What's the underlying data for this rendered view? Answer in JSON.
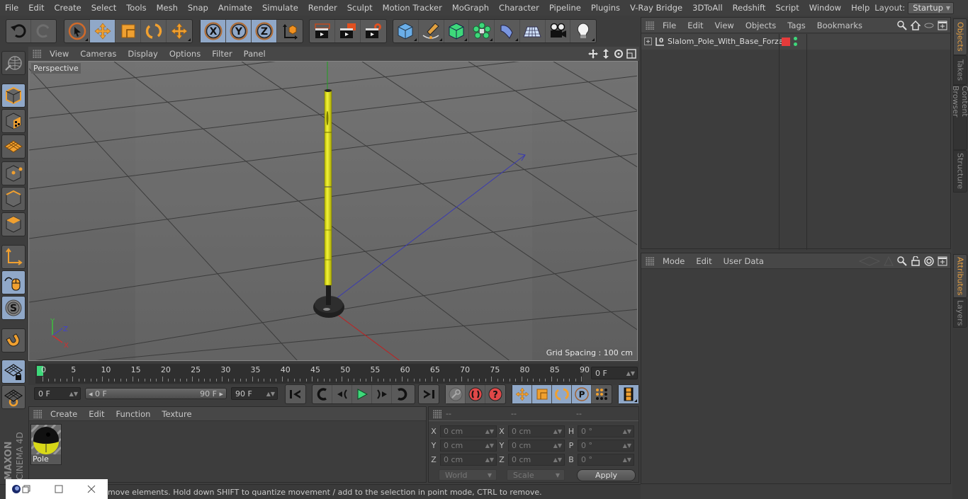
{
  "menubar": {
    "items": [
      "File",
      "Edit",
      "Create",
      "Select",
      "Tools",
      "Mesh",
      "Snap",
      "Animate",
      "Simulate",
      "Render",
      "Sculpt",
      "Motion Tracker",
      "MoGraph",
      "Character",
      "Pipeline",
      "Plugins",
      "V-Ray Bridge",
      "3DToAll",
      "Redshift",
      "Script",
      "Window",
      "Help"
    ],
    "layout_label": "Layout:",
    "layout_value": "Startup"
  },
  "toolbar": {
    "axis_x": "X",
    "axis_y": "Y",
    "axis_z": "Z"
  },
  "viewport": {
    "menu": [
      "View",
      "Cameras",
      "Display",
      "Options",
      "Filter",
      "Panel"
    ],
    "camera_label": "Perspective",
    "grid_spacing": "Grid Spacing : 100 cm",
    "axis_labels": {
      "x": "X",
      "y": "Y",
      "z": "Z"
    }
  },
  "timeline": {
    "ticks": [
      "0",
      "5",
      "10",
      "15",
      "20",
      "25",
      "30",
      "35",
      "40",
      "45",
      "50",
      "55",
      "60",
      "65",
      "70",
      "75",
      "80",
      "85",
      "90"
    ],
    "current_frame": "0 F",
    "start_frame": "0 F",
    "range_start": "0 F",
    "range_end": "90 F",
    "end_frame": "90 F"
  },
  "material_manager": {
    "menu": [
      "Create",
      "Edit",
      "Function",
      "Texture"
    ],
    "materials": [
      {
        "name": "Pole"
      }
    ]
  },
  "coordinates": {
    "headers": [
      "--",
      "--",
      "--"
    ],
    "rows": [
      {
        "l1": "X",
        "v1": "0 cm",
        "l2": "X",
        "v2": "0 cm",
        "l3": "H",
        "v3": "0 °"
      },
      {
        "l1": "Y",
        "v1": "0 cm",
        "l2": "Y",
        "v2": "0 cm",
        "l3": "P",
        "v3": "0 °"
      },
      {
        "l1": "Z",
        "v1": "0 cm",
        "l2": "Z",
        "v2": "0 cm",
        "l3": "B",
        "v3": "0 °"
      }
    ],
    "space_dropdown": "World",
    "mode_dropdown": "Scale",
    "apply_label": "Apply"
  },
  "status": {
    "text": "move elements. Hold down SHIFT to quantize movement / add to the selection in point mode, CTRL to remove."
  },
  "object_manager": {
    "menu": [
      "File",
      "Edit",
      "View",
      "Objects",
      "Tags",
      "Bookmarks"
    ],
    "objects": [
      {
        "name": "Slalom_Pole_With_Base_Forza",
        "layer_color": "#e53b3b"
      }
    ]
  },
  "attribute_manager": {
    "menu": [
      "Mode",
      "Edit",
      "User Data"
    ]
  },
  "side_tabs": {
    "top": [
      "Objects",
      "Takes",
      "Content Browser",
      "Structure"
    ],
    "bottom": [
      "Attributes",
      "Layers"
    ]
  },
  "branding": {
    "maxon": "MAXON",
    "product": "CINEMA 4D"
  },
  "colors": {
    "accent_orange": "#f0a030",
    "selected_blue": "#90a8c8",
    "play_green": "#3ed87a"
  }
}
